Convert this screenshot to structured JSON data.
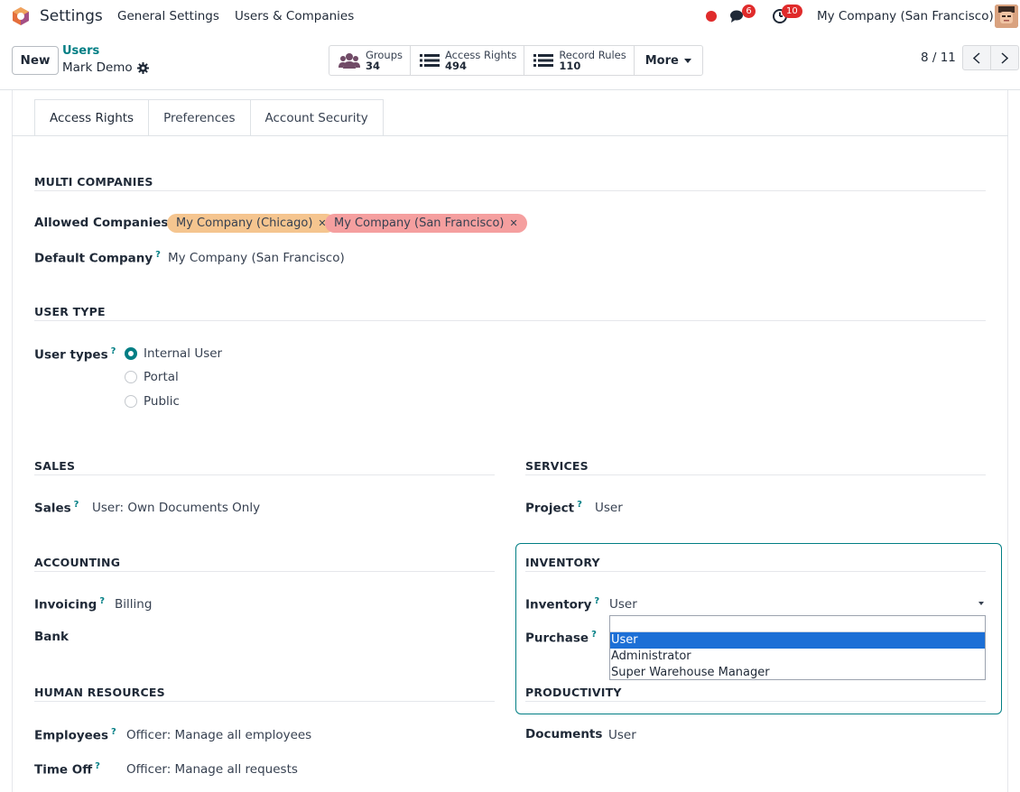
{
  "navbar": {
    "app_name": "Settings",
    "menus": [
      "General Settings",
      "Users & Companies"
    ],
    "chat_count": "6",
    "activity_count": "10",
    "company": "My Company (San Francisco)"
  },
  "control": {
    "new_label": "New",
    "breadcrumb_parent": "Users",
    "breadcrumb_current": "Mark Demo",
    "smart_buttons": [
      {
        "label": "Groups",
        "value": "34",
        "icon": "users-icon"
      },
      {
        "label": "Access Rights",
        "value": "494",
        "icon": "list-icon"
      },
      {
        "label": "Record Rules",
        "value": "110",
        "icon": "list-icon"
      }
    ],
    "more_label": "More",
    "pager": "8 / 11"
  },
  "tabs": [
    "Access Rights",
    "Preferences",
    "Account Security"
  ],
  "multi_companies": {
    "title": "MULTI COMPANIES",
    "allowed_label": "Allowed Companies",
    "allowed": [
      "My Company (Chicago)",
      "My Company (San Francisco)"
    ],
    "default_label": "Default Company",
    "default_value": "My Company (San Francisco)"
  },
  "user_type": {
    "title": "USER TYPE",
    "label": "User types",
    "options": [
      "Internal User",
      "Portal",
      "Public"
    ],
    "selected": "Internal User"
  },
  "sales": {
    "title": "SALES",
    "label": "Sales",
    "value": "User: Own Documents Only"
  },
  "services": {
    "title": "SERVICES",
    "label": "Project",
    "value": "User"
  },
  "accounting": {
    "title": "ACCOUNTING",
    "invoicing_label": "Invoicing",
    "invoicing_value": "Billing",
    "bank_label": "Bank"
  },
  "inventory": {
    "title": "INVENTORY",
    "inventory_label": "Inventory",
    "inventory_value": "User",
    "purchase_label": "Purchase",
    "dropdown_options": [
      "User",
      "Administrator",
      "Super Warehouse Manager"
    ],
    "dropdown_selected": "User"
  },
  "human_resources": {
    "title": "HUMAN RESOURCES",
    "employees_label": "Employees",
    "employees_value": "Officer: Manage all employees",
    "timeoff_label": "Time Off",
    "timeoff_value": "Officer: Manage all requests"
  },
  "productivity": {
    "title": "PRODUCTIVITY",
    "documents_label": "Documents",
    "documents_value": "User"
  },
  "colors": {
    "accent": "#017e84",
    "brand": "#714b67",
    "badge": "#e02b2b",
    "tag_chicago": "#f5c58f",
    "tag_sf": "#f59f9f"
  }
}
